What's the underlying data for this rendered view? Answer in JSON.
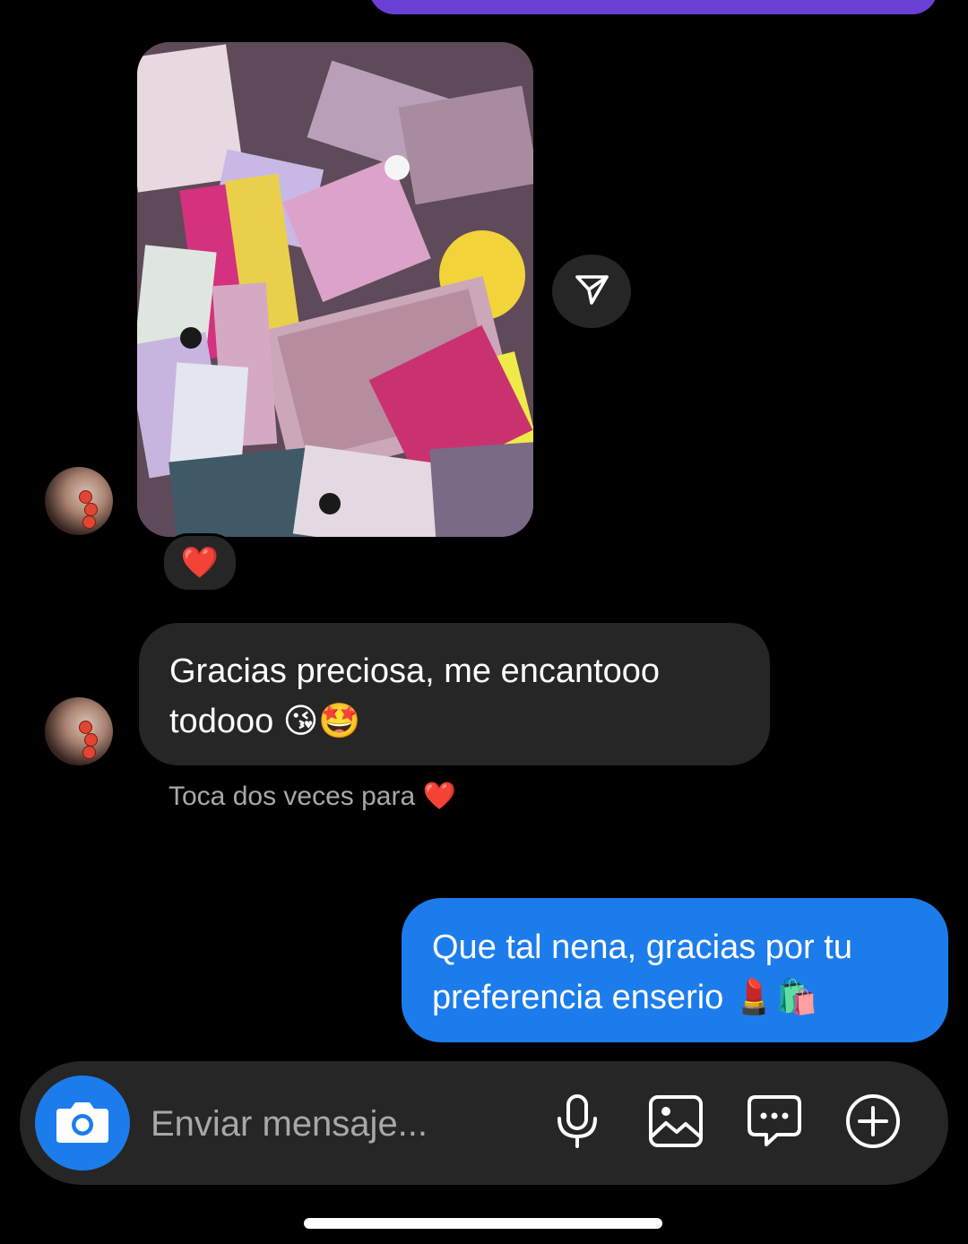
{
  "thread": {
    "received_image_reaction": "❤️",
    "received_message": {
      "line1": "Gracias preciosa, me encantooo",
      "line2": "todooo 😘🤩"
    },
    "double_tap_hint": "Toca dos veces para ❤️",
    "sent_message": {
      "line1": "Que tal nena, gracias por tu",
      "line2": "preferencia enserio 💄🛍️"
    }
  },
  "composer": {
    "placeholder": "Enviar mensaje..."
  },
  "colors": {
    "background": "#000000",
    "received_bubble": "#262626",
    "sent_bubble": "#1c7cec",
    "camera_button": "#1c7cec",
    "hint_text": "#a8a8a8",
    "previous_sent_bubble": "#6a3fd6"
  },
  "icons": [
    "send-icon",
    "camera-icon",
    "microphone-icon",
    "gallery-icon",
    "sticker-icon",
    "plus-icon"
  ]
}
